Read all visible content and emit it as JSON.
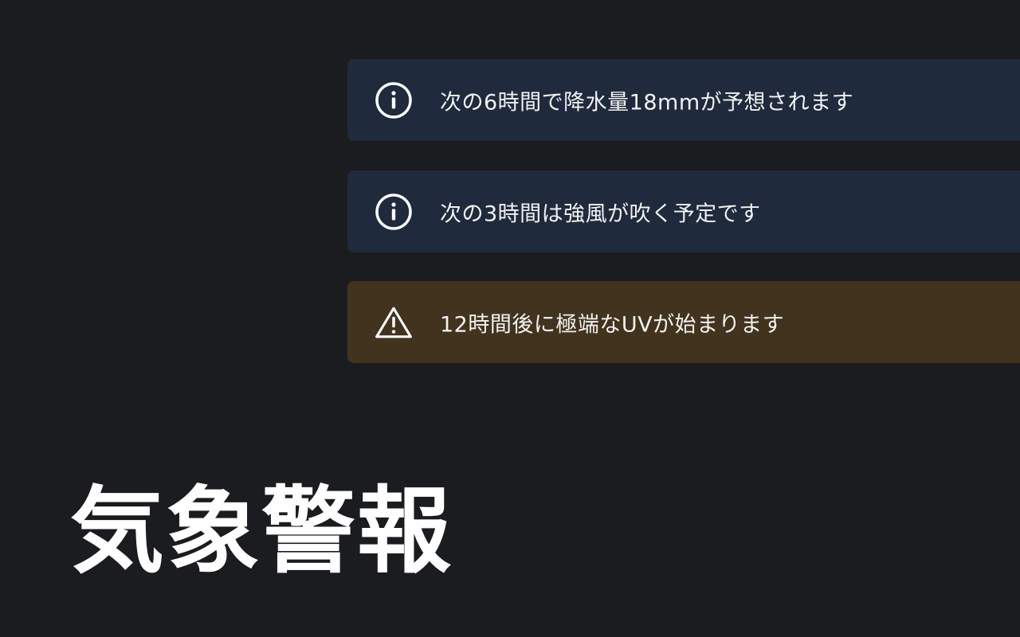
{
  "title": "気象警報",
  "alerts": [
    {
      "type": "info",
      "icon": "info-circle-icon",
      "message": "次の6時間で降水量18mmが予想されます"
    },
    {
      "type": "info",
      "icon": "info-circle-icon",
      "message": "次の3時間は強風が吹く予定です"
    },
    {
      "type": "warning",
      "icon": "warning-triangle-icon",
      "message": "12時間後に極端なUVが始まります"
    }
  ],
  "colors": {
    "background": "#1b1c20",
    "info_card": "#202a3d",
    "warning_card": "#42331f",
    "text": "#f2f2f2"
  }
}
